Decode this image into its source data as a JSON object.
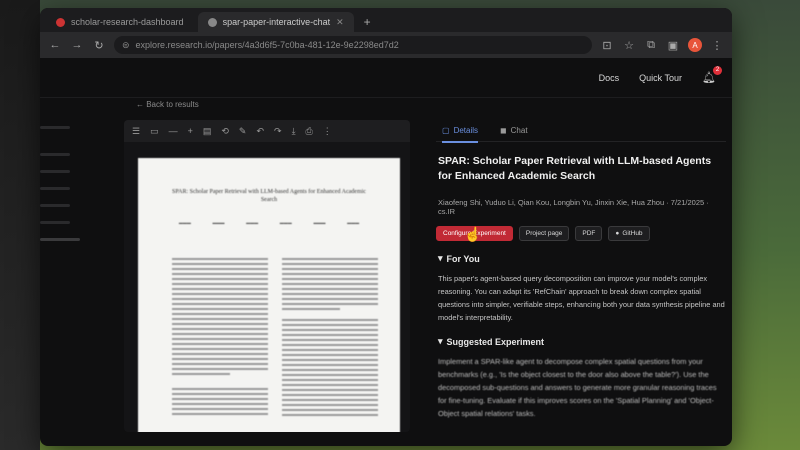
{
  "browser": {
    "tabs": [
      {
        "label": "scholar-research-dashboard"
      },
      {
        "label": "spar-paper-interactive-chat"
      }
    ],
    "new_tab": "+",
    "url": "explore.research.io/papers/4a3d6f5-7c0ba-481-12e-9e2298ed7d2"
  },
  "appbar": {
    "docs": "Docs",
    "quick_tour": "Quick Tour",
    "notif_count": "2"
  },
  "back_link": "← Back to results",
  "pdf": {
    "title": "SPAR: Scholar Paper Retrieval with LLM-based Agents for Enhanced Academic Search"
  },
  "right": {
    "tabs": [
      {
        "label": "Details"
      },
      {
        "label": "Chat"
      }
    ],
    "paper_title": "SPAR: Scholar Paper Retrieval with LLM-based Agents for Enhanced Academic Search",
    "meta": "Xiaofeng Shi, Yuduo Li, Qian Kou, Longbin Yu, Jinxin Xie, Hua Zhou · 7/21/2025 · cs.IR",
    "buttons": {
      "configure": "Configure Experiment",
      "project": "Project page",
      "pdf": "PDF",
      "github": "GitHub"
    },
    "for_you": {
      "heading": "For You",
      "body": "This paper's agent-based query decomposition can improve your model's complex reasoning. You can adapt its 'RefChain' approach to break down complex spatial questions into simpler, verifiable steps, enhancing both your data synthesis pipeline and model's interpretability."
    },
    "suggested": {
      "heading": "Suggested Experiment",
      "body": "Implement a SPAR-like agent to decompose complex spatial questions from your benchmarks (e.g., 'Is the object closest to the door also above the table?'). Use the decomposed sub-questions and answers to generate more granular reasoning traces for fine-tuning. Evaluate if this improves scores on the 'Spatial Planning' and 'Object-Object spatial relations' tasks."
    }
  },
  "colors": {
    "accent": "#6a8fdf",
    "primary_button": "#c12a35",
    "badge": "#e0303a"
  }
}
